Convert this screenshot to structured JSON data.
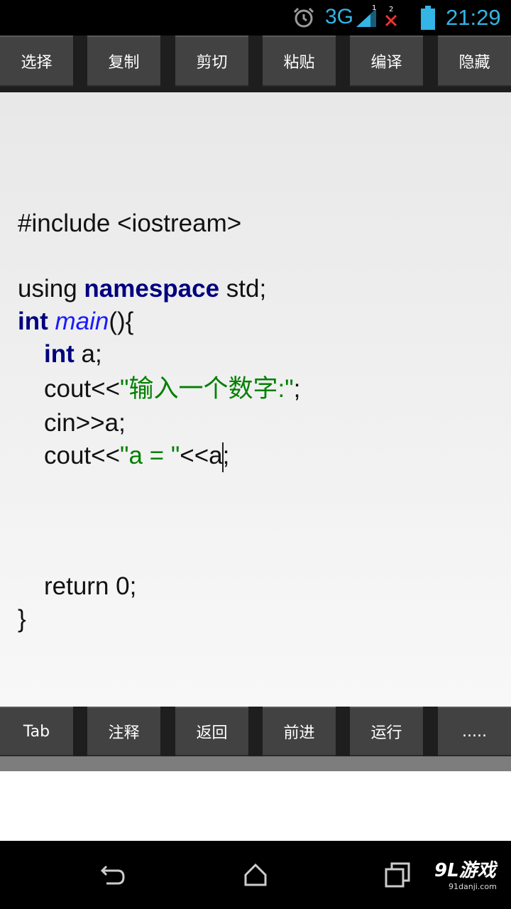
{
  "status_bar": {
    "network_type": "3G",
    "signal_sim1_label": "1",
    "signal_sim2_label": "2",
    "time": "21:29",
    "icons": [
      "alarm-icon",
      "signal-icon",
      "no-signal-icon",
      "battery-icon"
    ],
    "accent_color": "#33b5e5"
  },
  "top_toolbar": {
    "buttons": [
      "选择",
      "复制",
      "剪切",
      "粘贴",
      "编译",
      "隐藏"
    ]
  },
  "editor": {
    "lines": {
      "l1": "#include <iostream>",
      "l3_a": "using ",
      "l3_b": "namespace",
      "l3_c": " std;",
      "l4_a": "int",
      "l4_b": " ",
      "l4_c": "main",
      "l4_d": "(){",
      "l5_a": "int",
      "l5_b": " a;",
      "l6_a": "cout<<",
      "l6_b": "\"输入一个数字:\"",
      "l6_c": ";",
      "l7": "cin>>a;",
      "l8_a": "cout<<",
      "l8_b": "\"a = \"",
      "l8_c": "<<a",
      "l8_d": ";",
      "l12": "return 0;",
      "l13": "}"
    },
    "colors": {
      "keyword": "#000080",
      "function": "#1a1aff",
      "string": "#008000"
    }
  },
  "bottom_toolbar": {
    "buttons": [
      "Tab",
      "注释",
      "返回",
      "前进",
      "运行",
      "....."
    ]
  },
  "nav_bar": {
    "icons": [
      "back-icon",
      "home-icon",
      "recent-apps-icon"
    ]
  },
  "watermark": {
    "main": "9L游戏",
    "sub": "91danji.com"
  }
}
